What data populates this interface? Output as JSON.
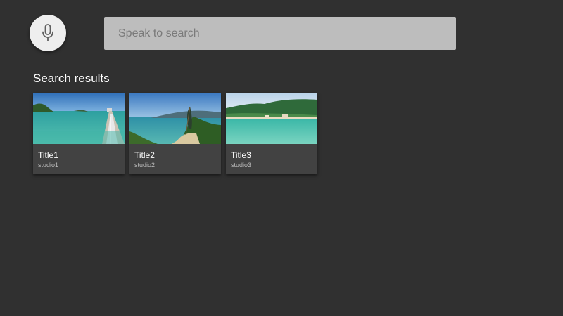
{
  "search": {
    "mic_icon": "microphone-icon",
    "placeholder": "Speak to search",
    "value": ""
  },
  "results_section": {
    "title": "Search results"
  },
  "results": [
    {
      "title": "Title1",
      "subtitle": "studio1",
      "image": "pier-over-turquoise-sea-photo"
    },
    {
      "title": "Title2",
      "subtitle": "studio2",
      "image": "palm-frond-beach-bay-photo"
    },
    {
      "title": "Title3",
      "subtitle": "studio3",
      "image": "green-hills-beach-lagoon-photo"
    }
  ],
  "colors": {
    "background": "#303030",
    "search_box": "#bdbdbd",
    "mic_button": "#eeeeee",
    "card": "#424242",
    "subtitle_text": "#bdbdbd"
  }
}
